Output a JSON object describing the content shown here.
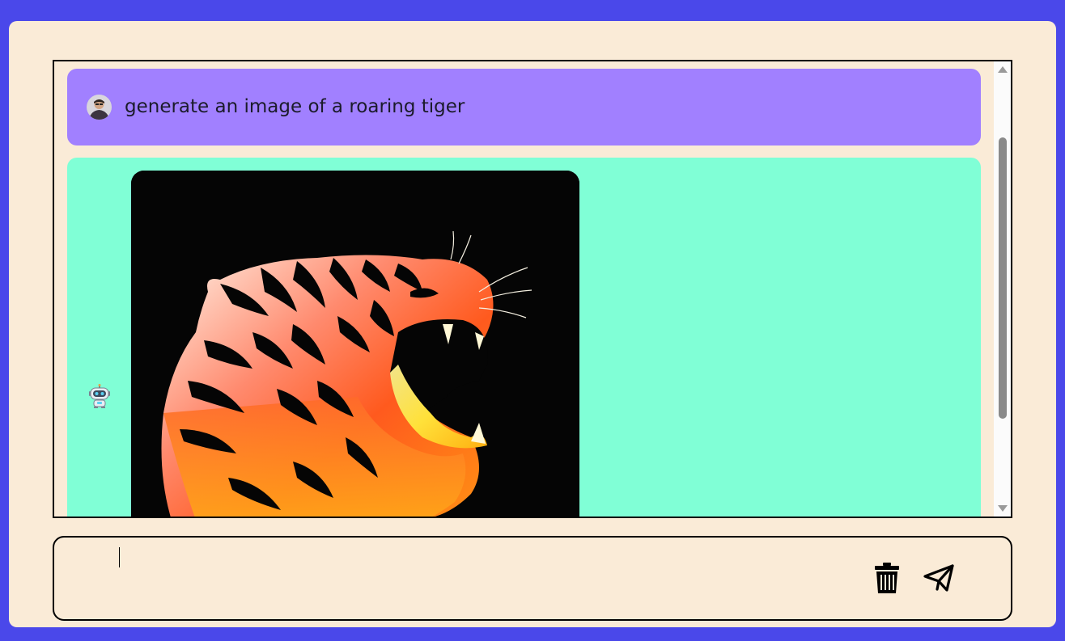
{
  "chat": {
    "messages": [
      {
        "role": "user",
        "avatar_icon": "user-avatar-icon",
        "text": "generate an image of a roaring tiger"
      },
      {
        "role": "assistant",
        "avatar_icon": "robot-avatar-icon",
        "image_subject": "roaring tiger"
      }
    ]
  },
  "composer": {
    "input_value": "",
    "delete_icon": "trash-icon",
    "send_icon": "paper-plane-icon"
  },
  "colors": {
    "page_background": "#4a48ea",
    "panel_background": "#faebd7",
    "user_bubble": "#a180ff",
    "assistant_bubble": "#80ffd6"
  }
}
